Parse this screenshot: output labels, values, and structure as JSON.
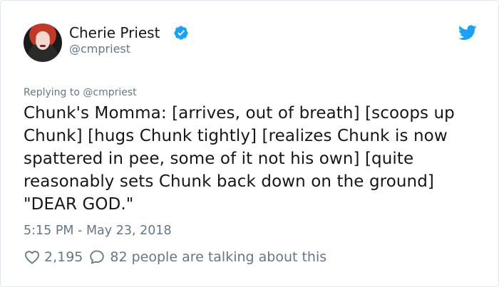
{
  "author": {
    "display_name": "Cherie Priest",
    "handle": "@cmpriest",
    "verified": true
  },
  "tweet": {
    "replying_to": "Replying to @cmpriest",
    "text_lines": [
      "Chunk's Momma: [arrives, out of breath] [scoops up",
      "Chunk] [hugs Chunk tightly] [realizes Chunk is now",
      "spattered in pee, some of it not his own] [quite",
      "reasonably sets Chunk back down on the ground]",
      "\"DEAR GOD.\""
    ],
    "timestamp": "5:15 PM - May 23, 2018"
  },
  "actions": {
    "likes": "2,195",
    "talking": "82 people are talking about this"
  },
  "icons": {
    "verified": "verified-badge-icon",
    "brand": "twitter-bird-icon",
    "like": "heart-icon",
    "reply": "speech-bubble-icon"
  },
  "colors": {
    "brand_blue": "#1da1f2",
    "text": "#14171a",
    "secondary": "#657786"
  }
}
